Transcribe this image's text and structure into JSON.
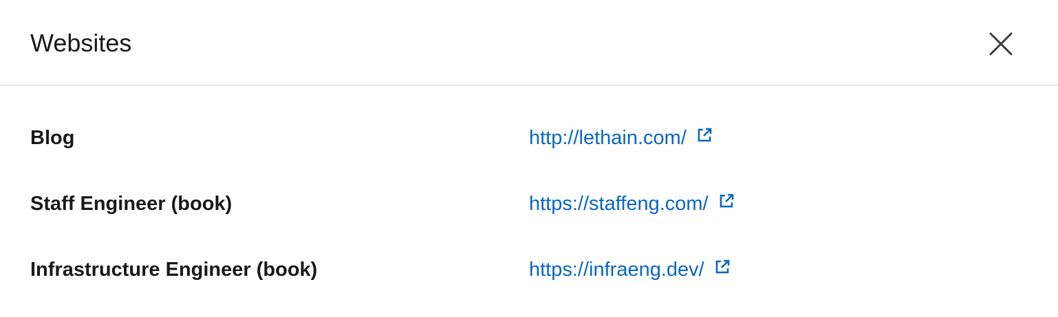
{
  "dialog": {
    "title": "Websites",
    "close_icon": "close-icon"
  },
  "websites": [
    {
      "label": "Blog",
      "url": "http://lethain.com/",
      "icon": "external-link-icon"
    },
    {
      "label": "Staff Engineer (book)",
      "url": "https://staffeng.com/",
      "icon": "external-link-icon"
    },
    {
      "label": "Infrastructure Engineer (book)",
      "url": "https://infraeng.dev/",
      "icon": "external-link-icon"
    }
  ],
  "colors": {
    "link": "#0a66c2",
    "text": "#191919",
    "divider": "#e8e8e8"
  }
}
